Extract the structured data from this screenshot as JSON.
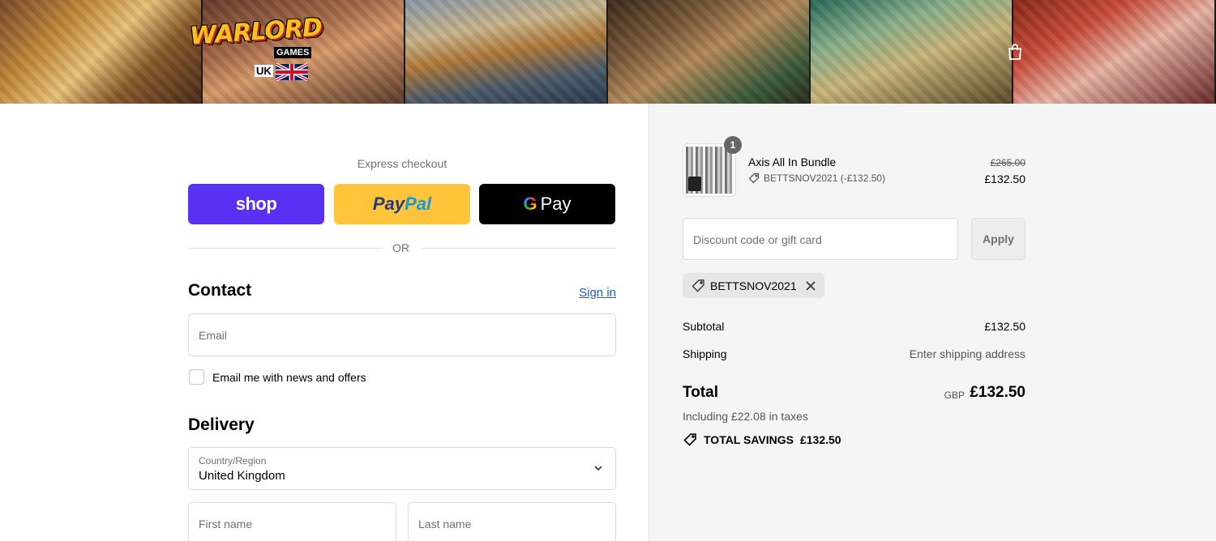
{
  "header": {
    "logo": {
      "word": "WARLORD",
      "sub": "GAMES",
      "region": "UK"
    },
    "cart_icon": "shopping-bag-icon"
  },
  "express": {
    "label": "Express checkout",
    "shop_label": "shop",
    "paypal_label_a": "Pay",
    "paypal_label_b": "Pal",
    "gpay_g": "G",
    "gpay_label": "Pay",
    "or_label": "OR"
  },
  "contact": {
    "heading": "Contact",
    "sign_in": "Sign in",
    "email_placeholder": "Email",
    "newsletter_label": "Email me with news and offers"
  },
  "delivery": {
    "heading": "Delivery",
    "country_label": "Country/Region",
    "country_value": "United Kingdom",
    "first_name_placeholder": "First name",
    "last_name_placeholder": "Last name"
  },
  "summary": {
    "item": {
      "quantity": "1",
      "name": "Axis All In Bundle",
      "discount": "BETTSNOV2021 (-£132.50)",
      "original_price": "£265.00",
      "price": "£132.50"
    },
    "discount_placeholder": "Discount code or gift card",
    "apply_label": "Apply",
    "applied_code": "BETTSNOV2021",
    "subtotal_label": "Subtotal",
    "subtotal_value": "£132.50",
    "shipping_label": "Shipping",
    "shipping_value": "Enter shipping address",
    "total_label": "Total",
    "total_currency": "GBP",
    "total_value": "£132.50",
    "tax_line": "Including £22.08 in taxes",
    "savings_label": "TOTAL SAVINGS",
    "savings_value": "£132.50"
  },
  "colors": {
    "shop_purple": "#5a31f4",
    "paypal_yellow": "#ffc439",
    "gpay_black": "#000000",
    "link_blue": "#1a5fc7",
    "summary_bg": "#f5f5f5"
  }
}
